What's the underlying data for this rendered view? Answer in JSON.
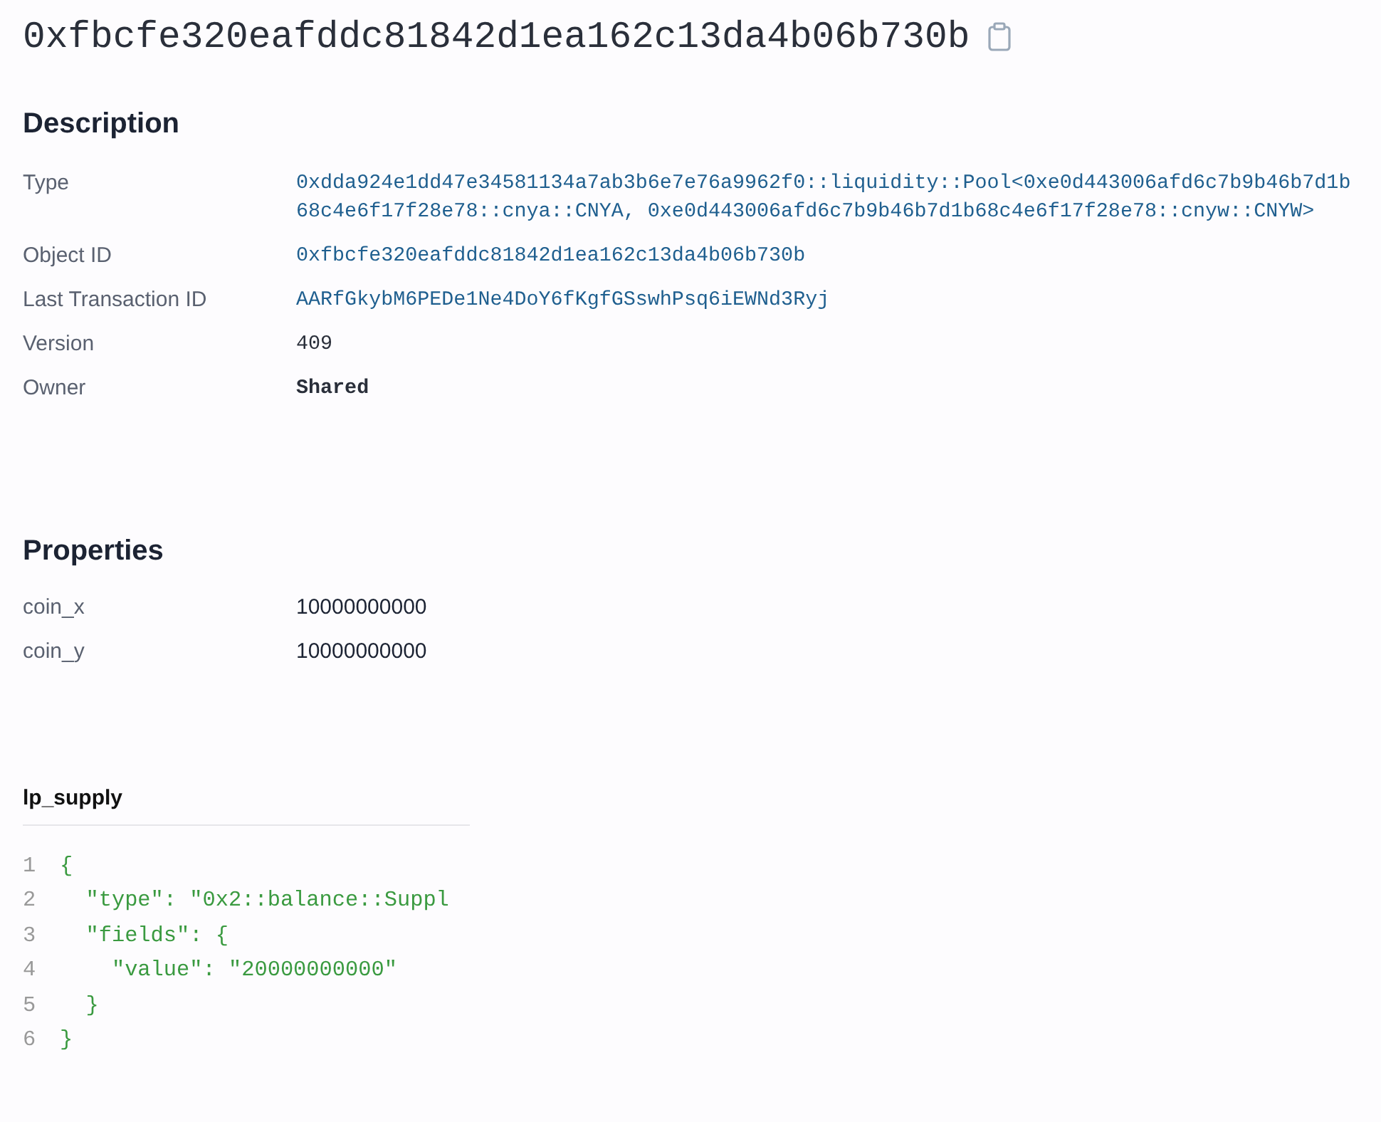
{
  "object_id": "0xfbcfe320eafddc81842d1ea162c13da4b06b730b",
  "description": {
    "heading": "Description",
    "rows": [
      {
        "label": "Type",
        "value": "0xdda924e1dd47e34581134a7ab3b6e7e76a9962f0::liquidity::Pool<0xe0d443006afd6c7b9b46b7d1b68c4e6f17f28e78::cnya::CNYA, 0xe0d443006afd6c7b9b46b7d1b68c4e6f17f28e78::cnyw::CNYW>",
        "kind": "link"
      },
      {
        "label": "Object ID",
        "value": "0xfbcfe320eafddc81842d1ea162c13da4b06b730b",
        "kind": "link"
      },
      {
        "label": "Last Transaction ID",
        "value": "AARfGkybM6PEDe1Ne4DoY6fKgfGSswhPsq6iEWNd3Ryj",
        "kind": "link"
      },
      {
        "label": "Version",
        "value": "409",
        "kind": "plain"
      },
      {
        "label": "Owner",
        "value": "Shared",
        "kind": "bold"
      }
    ]
  },
  "properties": {
    "heading": "Properties",
    "rows": [
      {
        "label": "coin_x",
        "value": "10000000000"
      },
      {
        "label": "coin_y",
        "value": "10000000000"
      }
    ]
  },
  "lp_supply": {
    "heading": "lp_supply",
    "lines": [
      {
        "number": "1",
        "text": "{"
      },
      {
        "number": "2",
        "text": "  \"type\": \"0x2::balance::Suppl"
      },
      {
        "number": "3",
        "text": "  \"fields\": {"
      },
      {
        "number": "4",
        "text": "    \"value\": \"20000000000\""
      },
      {
        "number": "5",
        "text": "  }"
      },
      {
        "number": "6",
        "text": "}"
      }
    ]
  }
}
